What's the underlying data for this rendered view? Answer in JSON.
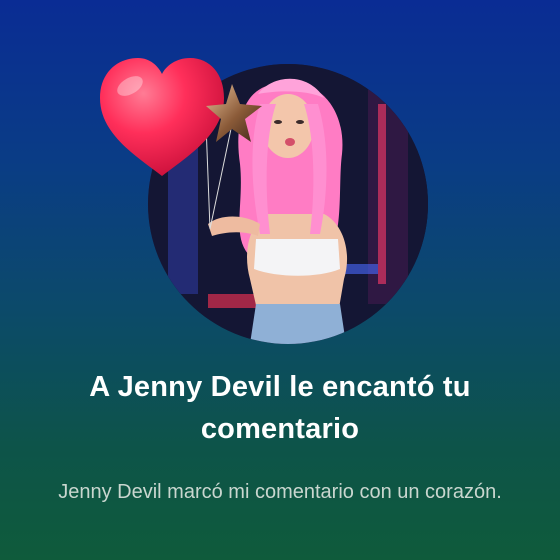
{
  "notification": {
    "title": "A Jenny Devil le encantó tu comentario",
    "subtitle": "Jenny Devil marcó mi comentario con un corazón."
  },
  "icons": {
    "reaction": "heart-balloon-icon",
    "decoration": "star-balloon-icon"
  },
  "colors": {
    "heart": "#ff2f5a",
    "hair": "#ff8fd0",
    "title_text": "#ffffff",
    "subtitle_text": "#c9d6cf"
  }
}
